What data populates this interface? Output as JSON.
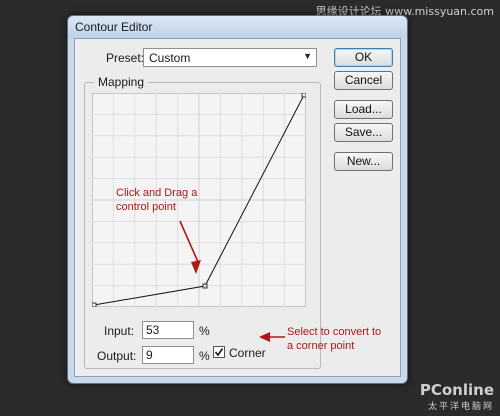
{
  "watermark": {
    "top": "思缘设计论坛 www.missyuan.com",
    "bottom_main": "PConline",
    "bottom_sub": "太平洋电脑网"
  },
  "window": {
    "title": "Contour Editor"
  },
  "preset": {
    "label": "Preset:",
    "value": "Custom"
  },
  "mapping": {
    "label": "Mapping"
  },
  "buttons": {
    "ok": "OK",
    "cancel": "Cancel",
    "load": "Load...",
    "save": "Save...",
    "new": "New..."
  },
  "input": {
    "label": "Input:",
    "value": "53",
    "unit": "%"
  },
  "output": {
    "label": "Output:",
    "value": "9",
    "unit": "%"
  },
  "corner": {
    "label": "Corner",
    "checked": true
  },
  "annotations": {
    "drag_line1": "Click and Drag a",
    "drag_line2": "control point",
    "select_line1": "Select to convert to",
    "select_line2": "a corner point"
  },
  "colors": {
    "annotation": "#b01616",
    "window_frame": "#c9d9ea"
  }
}
